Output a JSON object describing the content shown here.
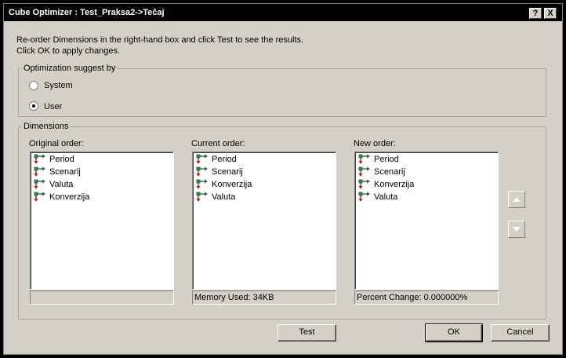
{
  "window": {
    "title": "Cube Optimizer : Test_Praksa2->Tečaj"
  },
  "titlebar_buttons": {
    "help": "?",
    "close": "X"
  },
  "instructions": {
    "line1": "Re-order Dimensions in the right-hand box and click Test to see the results.",
    "line2": "Click OK to apply changes."
  },
  "optimization": {
    "legend": "Optimization suggest by",
    "options": [
      {
        "label": "System",
        "selected": false
      },
      {
        "label": "User",
        "selected": true
      }
    ]
  },
  "dimensions": {
    "legend": "Dimensions",
    "original": {
      "label": "Original order:",
      "items": [
        "Period",
        "Scenarij",
        "Valuta",
        "Konverzija"
      ],
      "status": ""
    },
    "current": {
      "label": "Current order:",
      "items": [
        "Period",
        "Scenarij",
        "Konverzija",
        "Valuta"
      ],
      "status": "Memory Used: 34KB"
    },
    "new": {
      "label": "New order:",
      "items": [
        "Period",
        "Scenarij",
        "Konverzija",
        "Valuta"
      ],
      "status": "Percent Change: 0.000000%"
    }
  },
  "icons": {
    "dimension": "dimension-icon",
    "move_up": "up-arrow-icon",
    "move_down": "down-arrow-icon"
  },
  "buttons": {
    "test": "Test",
    "ok": "OK",
    "cancel": "Cancel"
  }
}
